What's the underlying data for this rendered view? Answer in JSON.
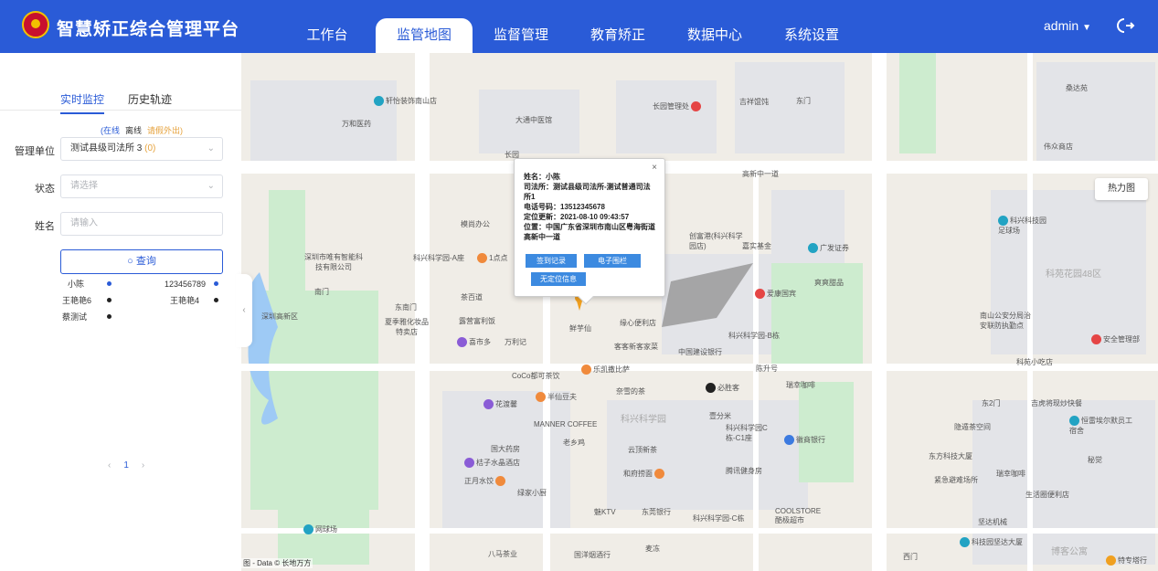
{
  "header": {
    "title": "智慧矫正综合管理平台",
    "nav": [
      "工作台",
      "监管地图",
      "监督管理",
      "教育矫正",
      "数据中心",
      "系统设置"
    ],
    "active_nav": "监管地图",
    "user": "admin",
    "colors": {
      "primary": "#2a5bd7"
    }
  },
  "sidebar": {
    "tabs": [
      "实时监控",
      "历史轨迹"
    ],
    "legend": {
      "online": "(在线",
      "offline": "离线",
      "leave": "请假外出)"
    },
    "unit_label": "管理单位",
    "unit_value": "测试县级司法所 3",
    "unit_count": "(0)",
    "status_label": "状态",
    "status_placeholder": "请选择",
    "name_label": "姓名",
    "name_placeholder": "请输入",
    "query_label": "查询",
    "people": [
      {
        "name": "小陈",
        "status": "online"
      },
      {
        "name": "123456789",
        "status": "online"
      },
      {
        "name": "王艳艳6",
        "status": "offline"
      },
      {
        "name": "王艳艳4",
        "status": "offline"
      },
      {
        "name": "蔡测试",
        "status": "offline"
      }
    ],
    "page": "1"
  },
  "map": {
    "heatmap_label": "热力图",
    "copyright": "图 - Data © 长地万方",
    "popup": {
      "name": "姓名：小陈",
      "office": "司法所：测试县级司法所-测试普通司法所1",
      "phone": "电话号码：13512345678",
      "updated": "定位更新：2021-08-10 09:43:57",
      "location": "位置：中国广东省深圳市南山区粤海街道高新中一道",
      "btn_checkin": "签到记录",
      "btn_fence": "电子围栏",
      "btn_noloc": "无定位信息"
    },
    "pois": [
      "轩怡装饰南山店",
      "万和医药",
      "大通中医馆",
      "长园",
      "长园管理处",
      "吉祥馄饨",
      "东门",
      "桑达苑",
      "伟众商店",
      "高新中一道",
      "深圳市唯有智能科技有限公司",
      "模尚办公",
      "科兴科学园-A座",
      "1点点",
      "创富港(科兴科学园店)",
      "嘉实基金",
      "广发证券",
      "爽爽甜品",
      "科兴科技园足球场",
      "科苑花园48区",
      "南门",
      "东南门",
      "深圳高新区",
      "夏季雅化妆品特卖店",
      "露营富利饭",
      "茶百道",
      "鲜芋仙",
      "缘心便利店",
      "喜市多",
      "万利记",
      "客客新客家菜",
      "中国建设银行",
      "科兴科学园-B栋",
      "爱康国宾",
      "南山公安分局治安联防执勤点",
      "安全管理部",
      "陈升号",
      "CoCo都可茶饮",
      "乐凯撒比萨",
      "瑞幸咖啡",
      "必胜客",
      "科苑小吃店",
      "半仙豆夫",
      "奈雪的茶",
      "花渡馨",
      "壹分米",
      "MANNER COFFEE",
      "科兴科学园",
      "科兴科学园C栋-C1座",
      "徽商银行",
      "国大药房",
      "老乡鸡",
      "云顶新茶",
      "桔子水晶酒店",
      "和府捞面",
      "腾讯健身房",
      "东方科技大厦",
      "紧急避难场所",
      "瑞幸咖啡",
      "正月水饺",
      "绿家小厨",
      "魅KTV",
      "东莞银行",
      "科兴科学园-C栋",
      "COOLSTORE酷极超市",
      "坚达机械",
      "西门",
      "网球场",
      "八马茶业",
      "国洋烟酒行",
      "麦冻",
      "博客公寓",
      "科技园坚达大厦",
      "特专塔行",
      "隐遁茶空间",
      "恒雷埃尔默员工宿舍",
      "生活圈便利店",
      "吉虎将现炒快餐",
      "东2门",
      "秘觉"
    ]
  }
}
